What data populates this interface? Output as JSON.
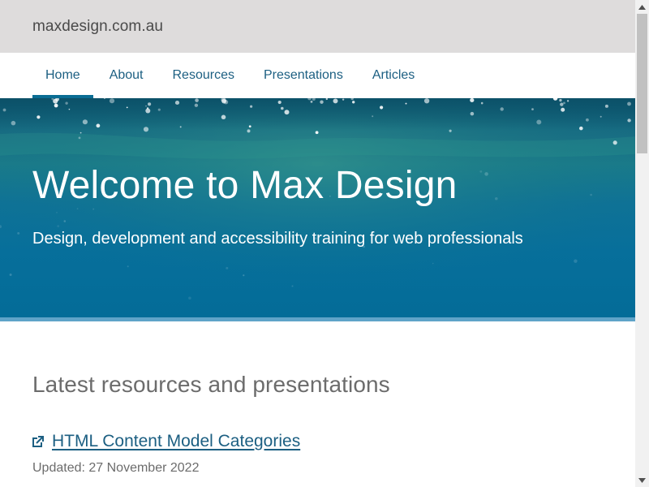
{
  "site": {
    "name": "maxdesign.com.au"
  },
  "nav": {
    "items": [
      {
        "label": "Home",
        "active": true
      },
      {
        "label": "About",
        "active": false
      },
      {
        "label": "Resources",
        "active": false
      },
      {
        "label": "Presentations",
        "active": false
      },
      {
        "label": "Articles",
        "active": false
      }
    ]
  },
  "hero": {
    "title": "Welcome to Max Design",
    "subtitle": "Design, development and accessibility training for web professionals"
  },
  "main": {
    "section_title": "Latest resources and presentations",
    "resources": [
      {
        "title": "HTML Content Model Categories",
        "icon": "external-link-icon",
        "updated": "Updated: 27 November 2022"
      }
    ]
  },
  "colors": {
    "header_bg": "#dedcdc",
    "link": "#1c5f82",
    "hero_bg": "#036c98",
    "hero_border": "#5fa3c8",
    "muted_text": "#6c6c6c"
  }
}
